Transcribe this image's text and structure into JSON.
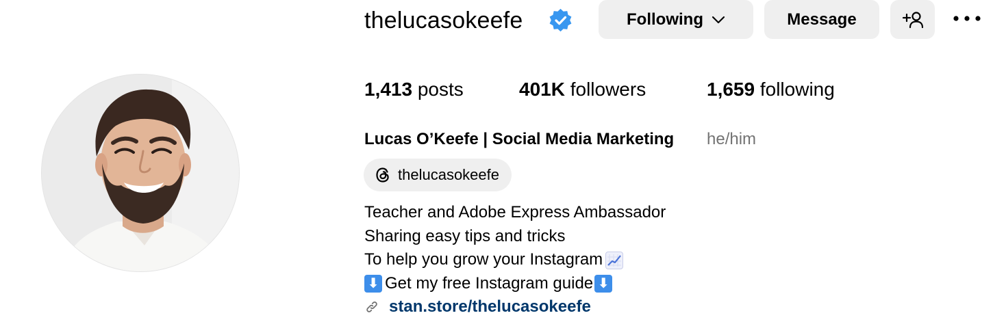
{
  "profile": {
    "username": "thelucasokeefe",
    "stats": {
      "posts_count": "1,413",
      "posts_label": " posts",
      "followers_count": "401K",
      "followers_label": " followers",
      "following_count": "1,659",
      "following_label": " following"
    },
    "full_name": "Lucas O’Keefe | Social Media Marketing",
    "pronouns": "he/him",
    "threads_handle": "thelucasokeefe",
    "bio_lines": [
      "Teacher and Adobe Express Ambassador",
      "Sharing easy tips and tricks",
      "To help you grow your Instagram",
      "Get my free Instagram guide"
    ],
    "link": "stan.store/thelucasokeefe"
  },
  "actions": {
    "following_label": "Following",
    "message_label": "Message"
  },
  "icons": {
    "verified": "verified-badge-icon",
    "chevron": "chevron-down-icon",
    "suggest": "add-person-icon",
    "more": "more-options-icon",
    "threads": "threads-logo-icon",
    "chart_emoji": "chart-increasing-emoji",
    "down_emoji": "down-arrow-emoji",
    "link": "link-icon"
  },
  "colors": {
    "verified_blue": "#0095f6",
    "button_bg": "#efefef",
    "link_text": "#00376b",
    "secondary_text": "#737373"
  }
}
